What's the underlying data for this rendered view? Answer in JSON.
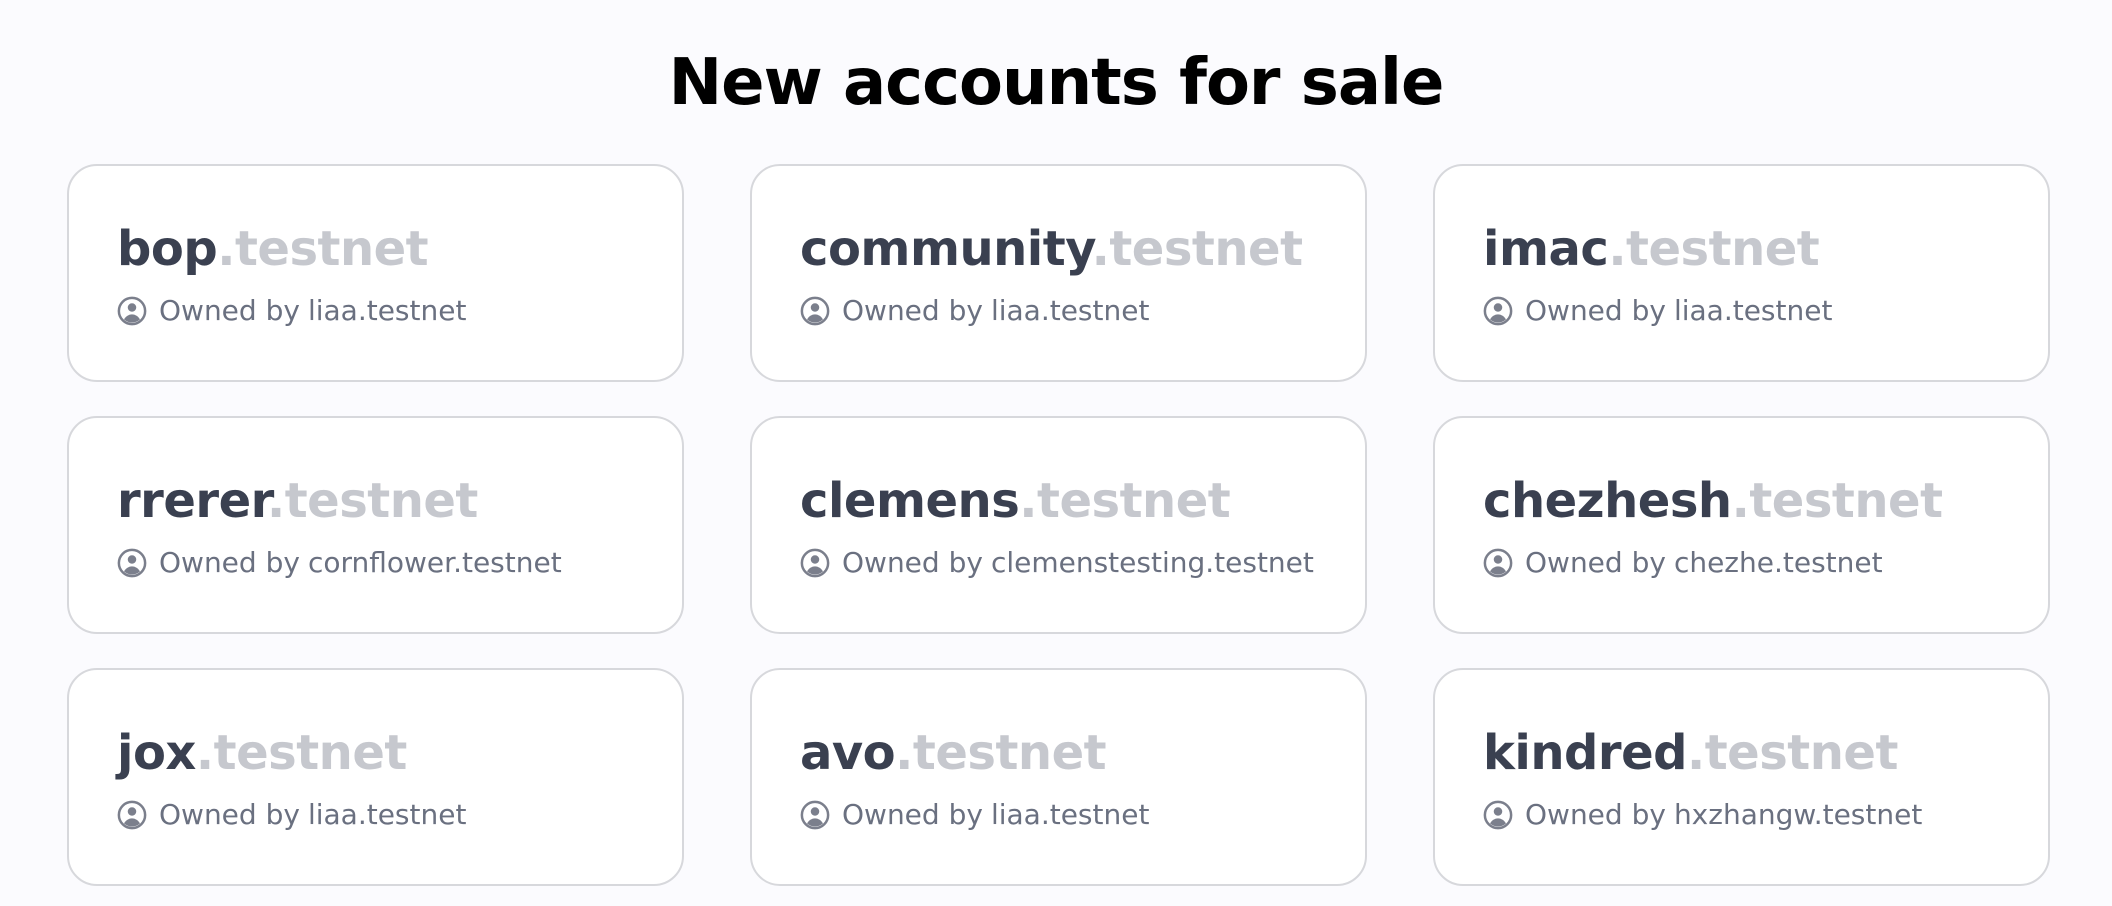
{
  "page": {
    "title": "New accounts for sale",
    "owner_prefix": "Owned by"
  },
  "colors": {
    "background": "#fbfbfe",
    "card_background": "#ffffff",
    "card_border": "#d7d8dc",
    "account_name": "#3a4050",
    "account_suffix": "#c6c8ce",
    "owner_text": "#6a7080",
    "user_icon": "#7b7f8c"
  },
  "accounts": [
    {
      "name": "bop",
      "suffix": ".testnet",
      "owner": "liaa.testnet",
      "icon": "user-circle-icon"
    },
    {
      "name": "community",
      "suffix": ".testnet",
      "owner": "liaa.testnet",
      "icon": "user-circle-icon"
    },
    {
      "name": "imac",
      "suffix": ".testnet",
      "owner": "liaa.testnet",
      "icon": "user-circle-icon"
    },
    {
      "name": "rrerer",
      "suffix": ".testnet",
      "owner": "cornflower.testnet",
      "icon": "user-circle-icon"
    },
    {
      "name": "clemens",
      "suffix": ".testnet",
      "owner": "clemenstesting.testnet",
      "icon": "user-circle-icon"
    },
    {
      "name": "chezhesh",
      "suffix": ".testnet",
      "owner": "chezhe.testnet",
      "icon": "user-circle-icon"
    },
    {
      "name": "jox",
      "suffix": ".testnet",
      "owner": "liaa.testnet",
      "icon": "user-circle-icon"
    },
    {
      "name": "avo",
      "suffix": ".testnet",
      "owner": "liaa.testnet",
      "icon": "user-circle-icon"
    },
    {
      "name": "kindred",
      "suffix": ".testnet",
      "owner": "hxzhangw.testnet",
      "icon": "user-circle-icon"
    }
  ]
}
